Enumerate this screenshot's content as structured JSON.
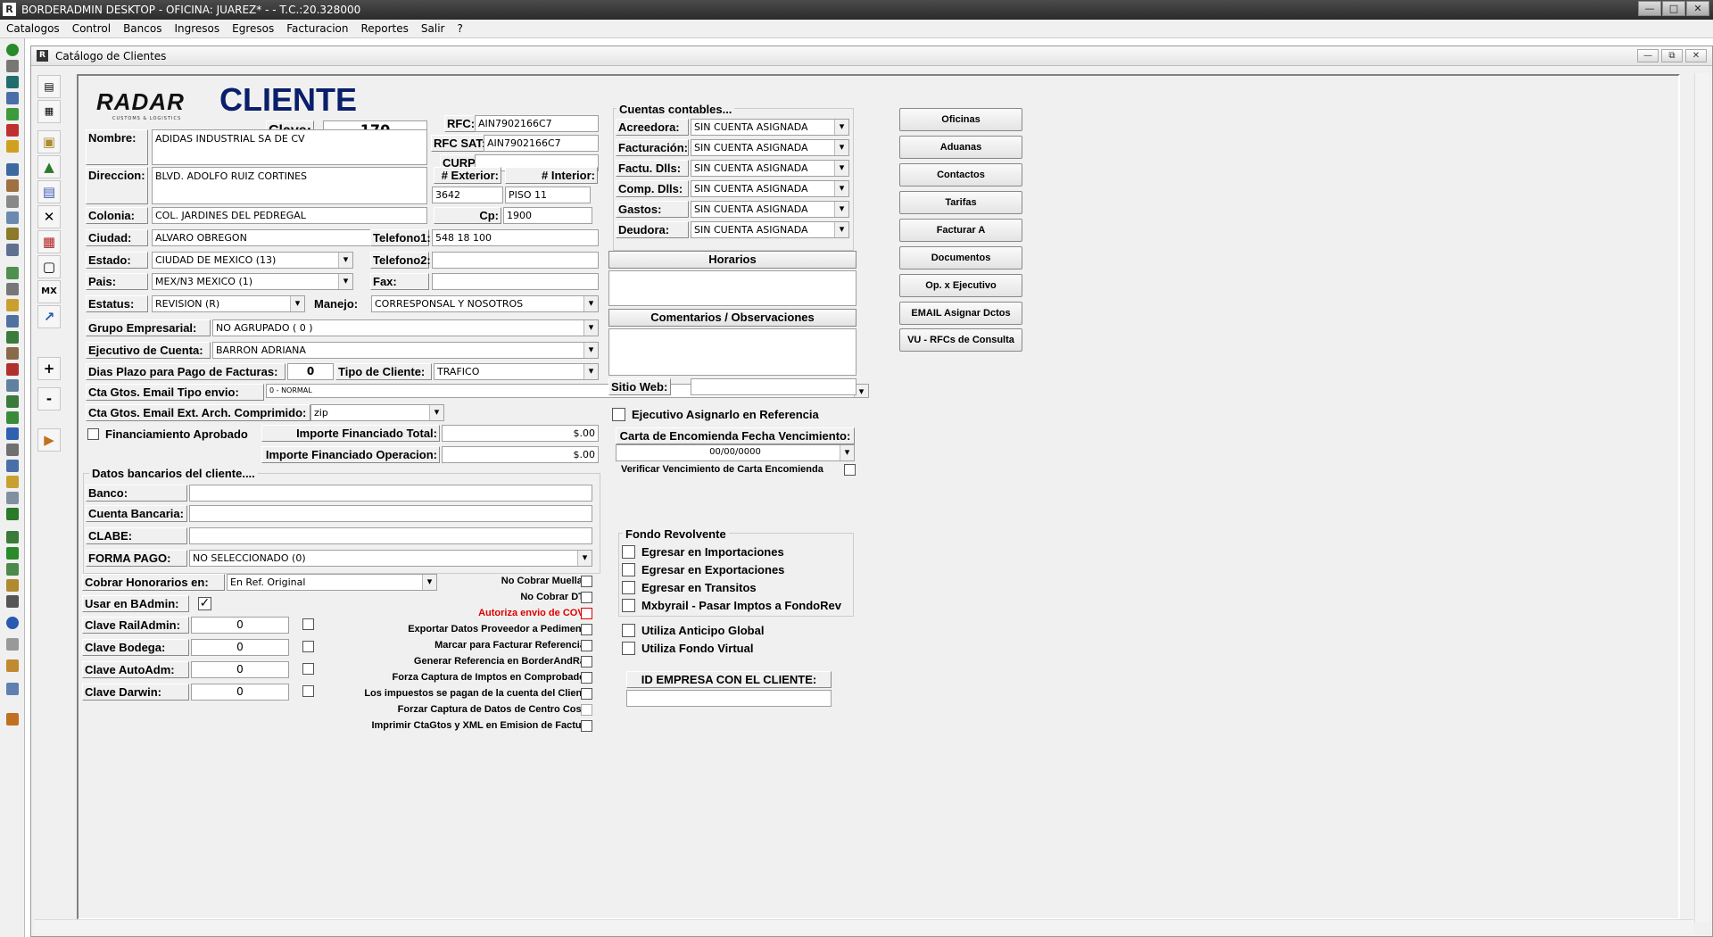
{
  "window": {
    "title": "BORDERADMIN DESKTOP - OFICINA: JUAREZ* -  - T.C.:20.328000",
    "icon": "R"
  },
  "menu": [
    "Catalogos",
    "Control",
    "Bancos",
    "Ingresos",
    "Egresos",
    "Facturacion",
    "Reportes",
    "Salir",
    "?"
  ],
  "child_window": {
    "title": "Catálogo de Clientes"
  },
  "inner_tools": {
    "mx_label": "MX",
    "plus": "+",
    "minus": "-"
  },
  "header": {
    "logo": "RADAR",
    "logo_sub": "CUSTOMS & LOGISTICS",
    "title": "CLIENTE"
  },
  "form": {
    "clave_label": "Clave:",
    "clave": "170",
    "rfc_label": "RFC:",
    "rfc": "AIN7902166C7",
    "rfcsat_label": "RFC SAT:",
    "rfcsat": "AIN7902166C7",
    "curp_label": "CURP:",
    "curp": "",
    "nombre_label": "Nombre:",
    "nombre": "ADIDAS INDUSTRIAL SA DE CV",
    "direccion_label": "Direccion:",
    "direccion": "BLVD. ADOLFO RUIZ CORTINES",
    "exterior_label": "# Exterior:",
    "exterior": "3642",
    "interior_label": "# Interior:",
    "interior": "PISO 11",
    "colonia_label": "Colonia:",
    "colonia": "COL. JARDINES DEL PEDREGAL",
    "cp_label": "Cp:",
    "cp": "1900",
    "ciudad_label": "Ciudad:",
    "ciudad": "ALVARO OBREGON",
    "tel1_label": "Telefono1:",
    "tel1": "548 18 100",
    "estado_label": "Estado:",
    "estado": "CIUDAD DE MEXICO (13)",
    "tel2_label": "Telefono2:",
    "tel2": "",
    "pais_label": "Pais:",
    "pais": "MEX/N3 MEXICO (1)",
    "fax_label": "Fax:",
    "fax": "",
    "estatus_label": "Estatus:",
    "estatus": "REVISION (R)",
    "manejo_label": "Manejo:",
    "manejo": "CORRESPONSAL Y NOSOTROS",
    "grupo_label": "Grupo Empresarial:",
    "grupo": "NO AGRUPADO ( 0 )",
    "ejecutivo_label": "Ejecutivo de Cuenta:",
    "ejecutivo": "BARRON ADRIANA",
    "dias_label": "Dias Plazo para Pago de Facturas:",
    "dias": "0",
    "tipo_label": "Tipo de Cliente:",
    "tipo": "TRAFICO",
    "email_tipo_label": "Cta Gtos. Email Tipo envio:",
    "email_tipo": "0 - NORMAL",
    "email_arch_label": "Cta Gtos. Email Ext. Arch. Comprimido:",
    "email_arch": "zip",
    "financ_label": "Financiamiento Aprobado",
    "imp_total_label": "Importe Financiado Total:",
    "imp_total": "$.00",
    "imp_oper_label": "Importe Financiado Operacion:",
    "imp_oper": "$.00",
    "datos_banc_title": "Datos bancarios del cliente....",
    "banco_label": "Banco:",
    "banco": "",
    "cuenta_label": "Cuenta Bancaria:",
    "cuenta": "",
    "clabe_label": "CLABE:",
    "clabe": "",
    "forma_label": "FORMA PAGO:",
    "forma": "NO SELECCIONADO (0)",
    "honorarios_label": "Cobrar Honorarios en:",
    "honorarios": "En Ref. Original",
    "usar_label": "Usar en BAdmin:",
    "usar_mark": "✓",
    "rail_label": "Clave RailAdmin:",
    "rail": "0",
    "bodega_label": "Clave Bodega:",
    "bodega": "0",
    "autoadm_label": "Clave AutoAdm:",
    "autoadm": "0",
    "darwin_label": "Clave Darwin:",
    "darwin": "0"
  },
  "options": [
    {
      "label": "No Cobrar Muellaje",
      "red": false
    },
    {
      "label": "No Cobrar DTA",
      "red": false
    },
    {
      "label": "Autoriza envio de COVE",
      "red": true
    },
    {
      "label": "Exportar Datos Proveedor a Pedimento",
      "red": false
    },
    {
      "label": "Marcar para Facturar Referencias",
      "red": false
    },
    {
      "label": "Generar Referencia en BorderAndRail",
      "red": false
    },
    {
      "label": "Forza Captura de Imptos en Comprobados",
      "red": false
    },
    {
      "label": "Los impuestos se pagan de la cuenta del Cliente",
      "red": false
    },
    {
      "label": "Forzar Captura de Datos de Centro Costo",
      "red": false
    },
    {
      "label": "Imprimir CtaGtos y XML en Emision de Factura",
      "red": false
    }
  ],
  "cuentas": {
    "title": "Cuentas contables...",
    "rows": [
      {
        "label": "Acreedora:",
        "value": "SIN CUENTA ASIGNADA"
      },
      {
        "label": "Facturación:",
        "value": "SIN CUENTA ASIGNADA"
      },
      {
        "label": "Factu. Dlls:",
        "value": "SIN CUENTA ASIGNADA"
      },
      {
        "label": "Comp. Dlls:",
        "value": "SIN CUENTA ASIGNADA"
      },
      {
        "label": "Gastos:",
        "value": "SIN CUENTA ASIGNADA"
      },
      {
        "label": "Deudora:",
        "value": "SIN CUENTA ASIGNADA"
      }
    ]
  },
  "horarios_label": "Horarios",
  "comentarios_label": "Comentarios / Observaciones",
  "sitio_label": "Sitio Web:",
  "sitio": "",
  "ejec_ref_label": "Ejecutivo Asignarlo en Referencia",
  "carta_label": "Carta de Encomienda Fecha Vencimiento:",
  "carta": "00/00/0000",
  "verificar_label": "Verificar Vencimiento de Carta Encomienda",
  "fondo": {
    "title": "Fondo Revolvente",
    "items": [
      "Egresar en Importaciones",
      "Egresar en Exportaciones",
      "Egresar en Transitos",
      "Mxbyrail - Pasar Imptos a FondoRev"
    ]
  },
  "anticipo_label": "Utiliza Anticipo Global",
  "fondo_virtual_label": "Utiliza Fondo Virtual",
  "id_empresa_label": "ID EMPRESA CON EL CLIENTE:",
  "id_empresa": "",
  "buttons": [
    "Oficinas",
    "Aduanas",
    "Contactos",
    "Tarifas",
    "Facturar A",
    "Documentos",
    "Op. x Ejecutivo",
    "EMAIL Asignar Dctos",
    "VU - RFCs de Consulta"
  ],
  "colors": {
    "title_blue": "#0a1f6b",
    "warning_red": "#e00000"
  }
}
